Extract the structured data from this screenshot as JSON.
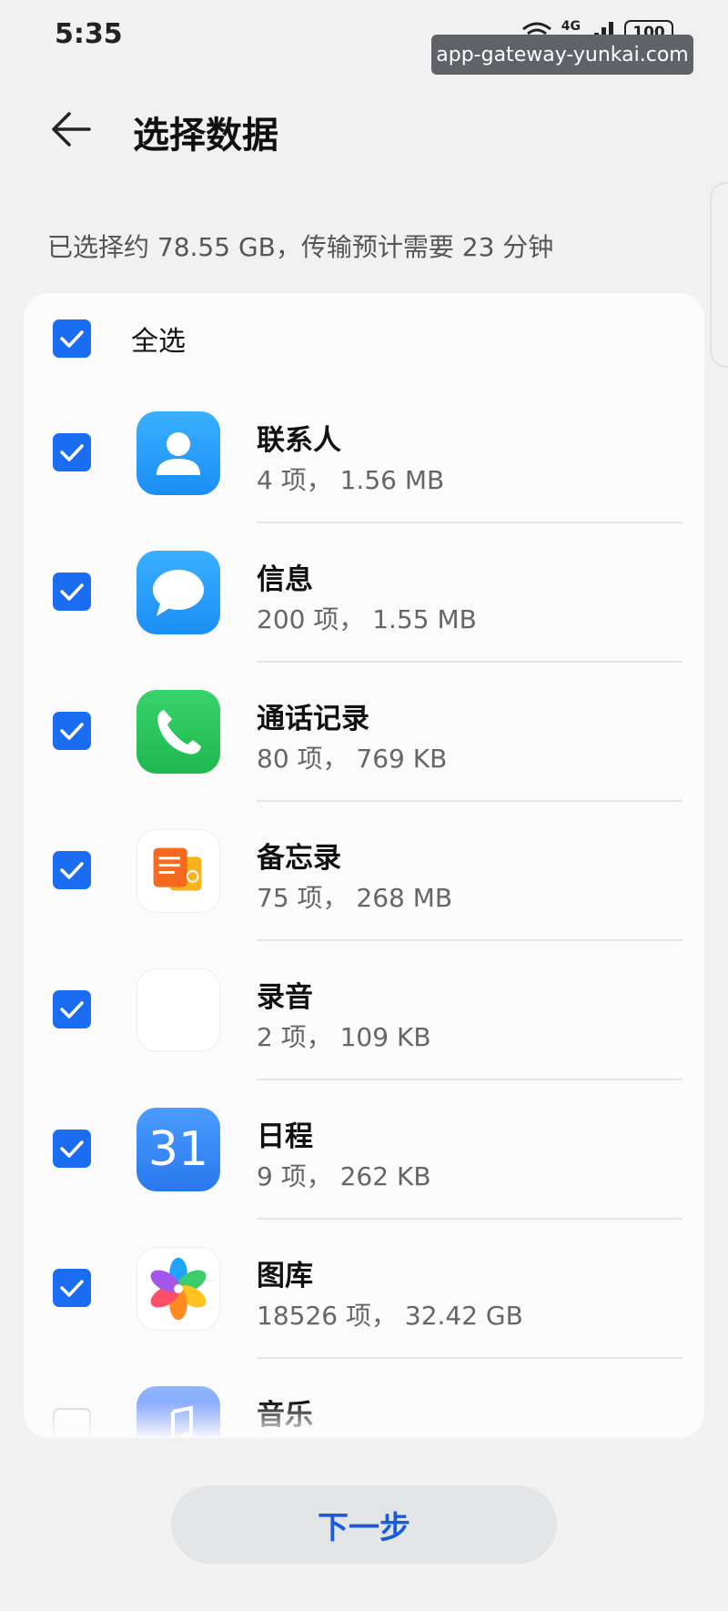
{
  "status_bar": {
    "time": "5:35",
    "network": "4G",
    "battery": "100"
  },
  "url_badge": "app-gateway-yunkai.com",
  "header": {
    "title": "选择数据"
  },
  "summary": "已选择约 78.55 GB，传输预计需要 23 分钟",
  "select_all": {
    "label": "全选",
    "checked": true
  },
  "items": [
    {
      "name": "联系人",
      "meta": "4 项， 1.56 MB",
      "checked": true,
      "icon": "contacts-icon"
    },
    {
      "name": "信息",
      "meta": "200 项， 1.55 MB",
      "checked": true,
      "icon": "messages-icon"
    },
    {
      "name": "通话记录",
      "meta": "80 项， 769 KB",
      "checked": true,
      "icon": "phone-icon"
    },
    {
      "name": "备忘录",
      "meta": "75 项， 268 MB",
      "checked": true,
      "icon": "notes-icon"
    },
    {
      "name": "录音",
      "meta": "2 项， 109 KB",
      "checked": true,
      "icon": "recorder-icon"
    },
    {
      "name": "日程",
      "meta": "9 项， 262 KB",
      "checked": true,
      "icon": "calendar-icon",
      "icon_text": "31"
    },
    {
      "name": "图库",
      "meta": "18526 项， 32.42 GB",
      "checked": true,
      "icon": "gallery-icon"
    },
    {
      "name": "音乐",
      "meta": "",
      "checked": false,
      "icon": "music-icon"
    }
  ],
  "next_button": "下一步",
  "colors": {
    "accent": "#1a6cf0",
    "button_text": "#1a5cd8",
    "background": "#f1f1f1"
  }
}
